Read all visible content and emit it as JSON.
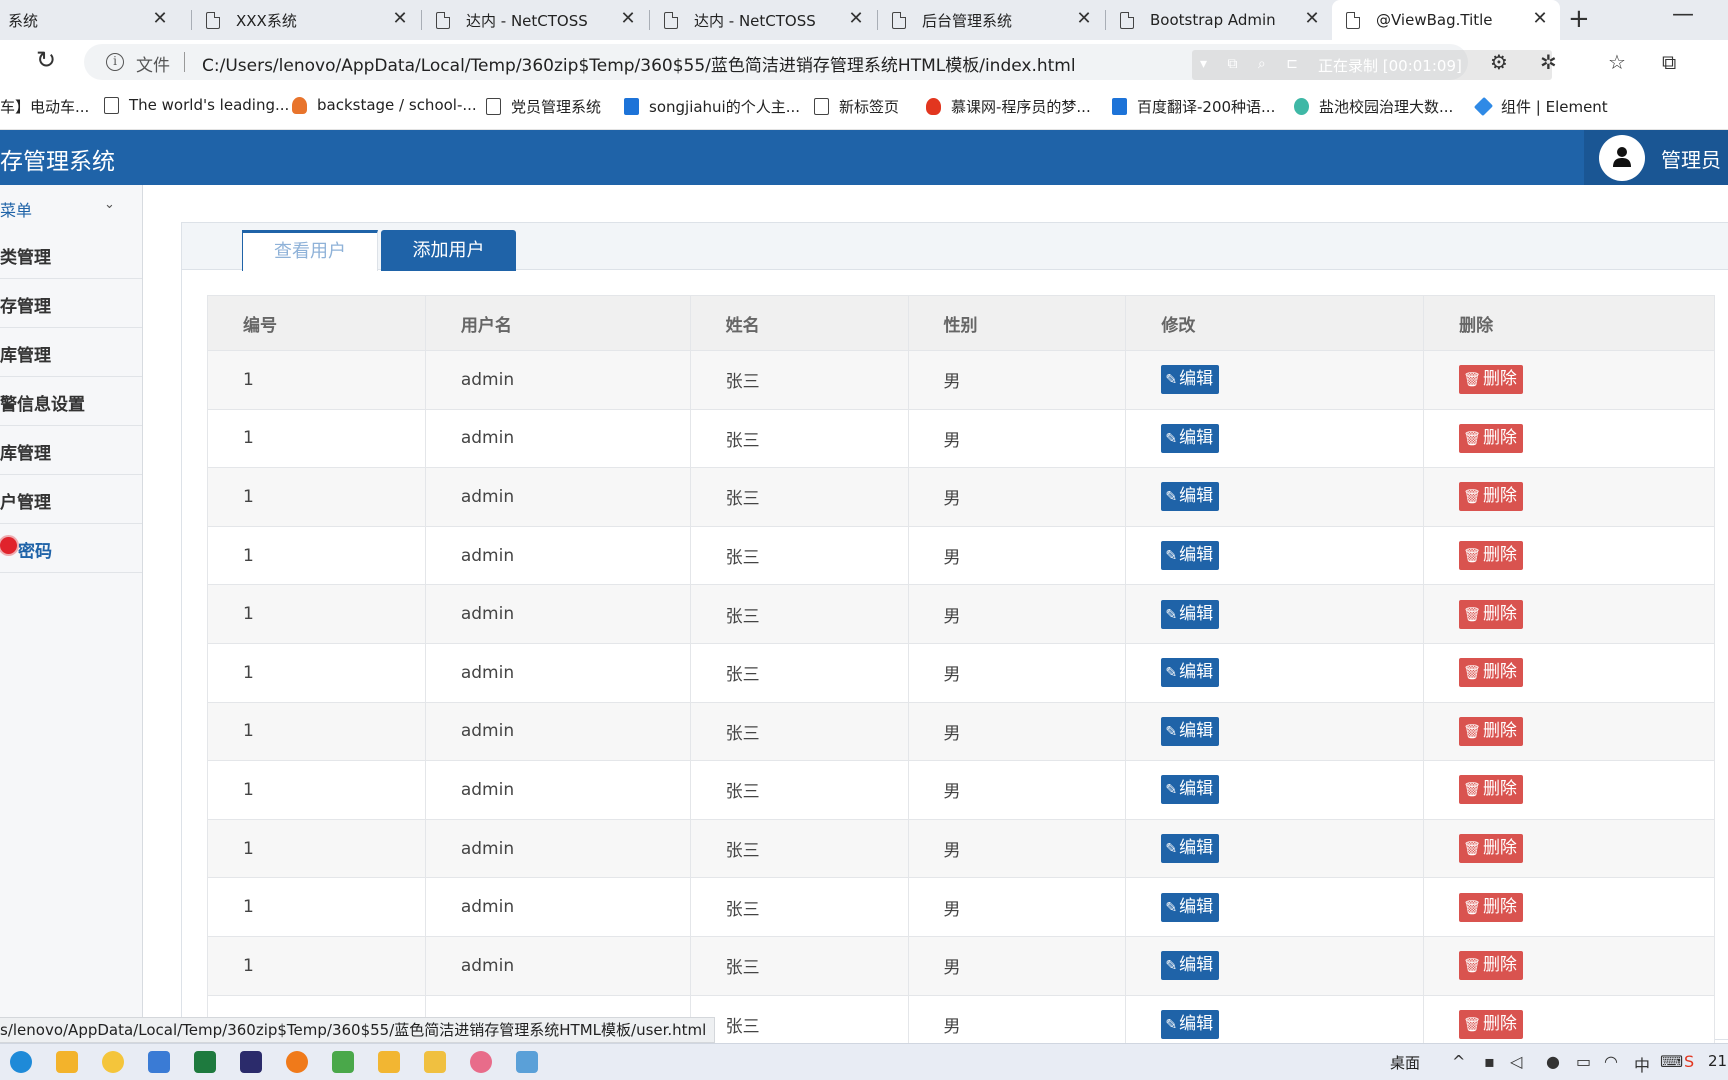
{
  "browser": {
    "tabs": [
      {
        "title": "系统"
      },
      {
        "title": "XXX系统"
      },
      {
        "title": "达内 - NetCTOSS"
      },
      {
        "title": "达内 - NetCTOSS"
      },
      {
        "title": "后台管理系统"
      },
      {
        "title": "Bootstrap Admin"
      },
      {
        "title": "@ViewBag.Title"
      }
    ],
    "address": {
      "label": "文件",
      "url": "C:/Users/lenovo/AppData/Local/Temp/360zip$Temp/360$55/蓝色简洁进销存管理系统HTML模板/index.html"
    },
    "recording_text": "正在录制 [00:01:09]",
    "bookmarks": [
      {
        "label": "车】电动车...",
        "icon": "none"
      },
      {
        "label": "The world's leading...",
        "icon": "page-icon"
      },
      {
        "label": "backstage / school-...",
        "icon": "gitlab-icon"
      },
      {
        "label": "党员管理系统",
        "icon": "page-icon"
      },
      {
        "label": "songjiahui的个人主...",
        "icon": "csdn-icon"
      },
      {
        "label": "新标签页",
        "icon": "page-icon"
      },
      {
        "label": "慕课网-程序员的梦...",
        "icon": "flame-icon"
      },
      {
        "label": "百度翻译-200种语...",
        "icon": "translate-icon"
      },
      {
        "label": "盐池校园治理大数...",
        "icon": "leaf-icon"
      },
      {
        "label": "组件 | Element",
        "icon": "element-icon"
      }
    ],
    "status_url": "s/lenovo/AppData/Local/Temp/360zip$Temp/360$55/蓝色简洁进销存管理系统HTML模板/user.html"
  },
  "app": {
    "title": "存管理系统",
    "user": "管理员",
    "brand_color": "#1f63a8",
    "danger_color": "#d9534f"
  },
  "sidebar": {
    "header": "菜单",
    "items": [
      {
        "label": "类管理"
      },
      {
        "label": "存管理"
      },
      {
        "label": "库管理"
      },
      {
        "label": "警信息设置"
      },
      {
        "label": "库管理"
      },
      {
        "label": "户管理"
      },
      {
        "label": "密码"
      }
    ]
  },
  "main": {
    "tabs": [
      {
        "label": "查看用户",
        "active": true
      },
      {
        "label": "添加用户",
        "active": false
      }
    ],
    "table": {
      "headers": [
        "编号",
        "用户名",
        "姓名",
        "性别",
        "修改",
        "删除"
      ],
      "edit_label": "编辑",
      "delete_label": "删除",
      "rows": [
        {
          "id": "1",
          "username": "admin",
          "name": "张三",
          "gender": "男"
        },
        {
          "id": "1",
          "username": "admin",
          "name": "张三",
          "gender": "男"
        },
        {
          "id": "1",
          "username": "admin",
          "name": "张三",
          "gender": "男"
        },
        {
          "id": "1",
          "username": "admin",
          "name": "张三",
          "gender": "男"
        },
        {
          "id": "1",
          "username": "admin",
          "name": "张三",
          "gender": "男"
        },
        {
          "id": "1",
          "username": "admin",
          "name": "张三",
          "gender": "男"
        },
        {
          "id": "1",
          "username": "admin",
          "name": "张三",
          "gender": "男"
        },
        {
          "id": "1",
          "username": "admin",
          "name": "张三",
          "gender": "男"
        },
        {
          "id": "1",
          "username": "admin",
          "name": "张三",
          "gender": "男"
        },
        {
          "id": "1",
          "username": "admin",
          "name": "张三",
          "gender": "男"
        },
        {
          "id": "1",
          "username": "admin",
          "name": "张三",
          "gender": "男"
        },
        {
          "id": "",
          "username": "",
          "name": "张三",
          "gender": "男"
        }
      ]
    }
  },
  "taskbar": {
    "desktop_label": "桌面",
    "ime": "中",
    "clock": "21"
  }
}
